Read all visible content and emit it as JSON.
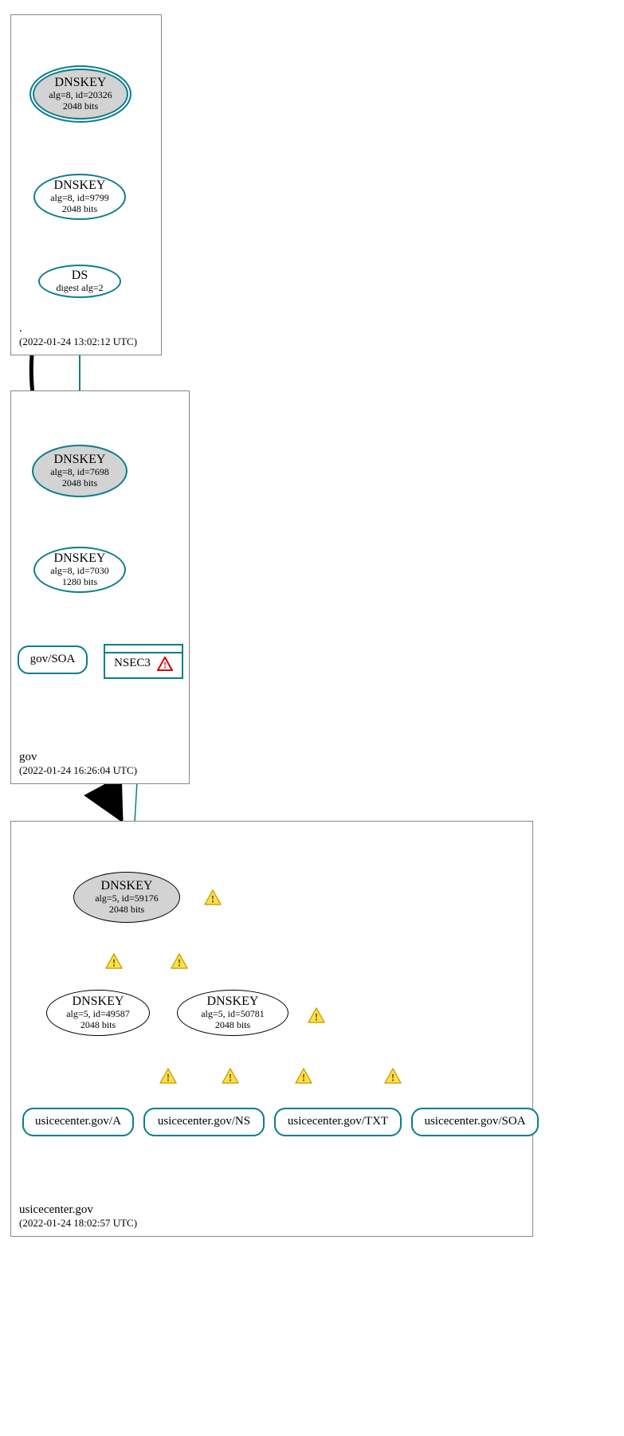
{
  "colors": {
    "teal": "#0a7e8c",
    "black": "#000000",
    "gray_fill": "#d3d3d3",
    "warn_fill": "#ffde4a",
    "warn_stroke": "#c9a200",
    "err_fill": "#ffffff",
    "err_stroke": "#d40000"
  },
  "zones": {
    "root": {
      "name": ".",
      "timestamp": "(2022-01-24 13:02:12 UTC)"
    },
    "gov": {
      "name": "gov",
      "timestamp": "(2022-01-24 16:26:04 UTC)"
    },
    "usicecenter": {
      "name": "usicecenter.gov",
      "timestamp": "(2022-01-24 18:02:57 UTC)"
    }
  },
  "nodes": {
    "root_ksk": {
      "title": "DNSKEY",
      "line2": "alg=8, id=20326",
      "line3": "2048 bits"
    },
    "root_zsk": {
      "title": "DNSKEY",
      "line2": "alg=8, id=9799",
      "line3": "2048 bits"
    },
    "root_ds": {
      "title": "DS",
      "line2": "digest alg=2"
    },
    "gov_ksk": {
      "title": "DNSKEY",
      "line2": "alg=8, id=7698",
      "line3": "2048 bits"
    },
    "gov_zsk": {
      "title": "DNSKEY",
      "line2": "alg=8, id=7030",
      "line3": "1280 bits"
    },
    "gov_soa": {
      "label": "gov/SOA"
    },
    "gov_nsec3": {
      "label": "NSEC3"
    },
    "uic_ksk": {
      "title": "DNSKEY",
      "line2": "alg=5, id=59176",
      "line3": "2048 bits"
    },
    "uic_zsk1": {
      "title": "DNSKEY",
      "line2": "alg=5, id=49587",
      "line3": "2048 bits"
    },
    "uic_zsk2": {
      "title": "DNSKEY",
      "line2": "alg=5, id=50781",
      "line3": "2048 bits"
    },
    "uic_a": {
      "label": "usicecenter.gov/A"
    },
    "uic_ns": {
      "label": "usicecenter.gov/NS"
    },
    "uic_txt": {
      "label": "usicecenter.gov/TXT"
    },
    "uic_soa": {
      "label": "usicecenter.gov/SOA"
    }
  },
  "icons": {
    "warning": "warning-triangle",
    "error": "error-triangle"
  },
  "chart_data": {
    "type": "graph",
    "description": "DNSSEC authentication chain / dnsviz-style delegation graph",
    "zones": [
      {
        "id": "root",
        "label": ".",
        "timestamp": "2022-01-24 13:02:12 UTC"
      },
      {
        "id": "gov",
        "label": "gov",
        "timestamp": "2022-01-24 16:26:04 UTC"
      },
      {
        "id": "usicecenter",
        "label": "usicecenter.gov",
        "timestamp": "2022-01-24 18:02:57 UTC"
      }
    ],
    "nodes": [
      {
        "id": "root_ksk",
        "zone": "root",
        "type": "DNSKEY",
        "role": "KSK",
        "alg": 8,
        "key_id": 20326,
        "bits": 2048,
        "trust_anchor": true
      },
      {
        "id": "root_zsk",
        "zone": "root",
        "type": "DNSKEY",
        "role": "ZSK",
        "alg": 8,
        "key_id": 9799,
        "bits": 2048
      },
      {
        "id": "root_ds",
        "zone": "root",
        "type": "DS",
        "digest_alg": 2
      },
      {
        "id": "gov_ksk",
        "zone": "gov",
        "type": "DNSKEY",
        "role": "KSK",
        "alg": 8,
        "key_id": 7698,
        "bits": 2048
      },
      {
        "id": "gov_zsk",
        "zone": "gov",
        "type": "DNSKEY",
        "role": "ZSK",
        "alg": 8,
        "key_id": 7030,
        "bits": 1280
      },
      {
        "id": "gov_soa",
        "zone": "gov",
        "type": "RRset",
        "name": "gov/SOA"
      },
      {
        "id": "gov_nsec3",
        "zone": "gov",
        "type": "NSEC3",
        "status": "error"
      },
      {
        "id": "uic_ksk",
        "zone": "usicecenter",
        "type": "DNSKEY",
        "role": "KSK",
        "alg": 5,
        "key_id": 59176,
        "bits": 2048,
        "status": "warning"
      },
      {
        "id": "uic_zsk1",
        "zone": "usicecenter",
        "type": "DNSKEY",
        "role": "ZSK",
        "alg": 5,
        "key_id": 49587,
        "bits": 2048
      },
      {
        "id": "uic_zsk2",
        "zone": "usicecenter",
        "type": "DNSKEY",
        "role": "ZSK",
        "alg": 5,
        "key_id": 50781,
        "bits": 2048,
        "status": "warning"
      },
      {
        "id": "uic_a",
        "zone": "usicecenter",
        "type": "RRset",
        "name": "usicecenter.gov/A"
      },
      {
        "id": "uic_ns",
        "zone": "usicecenter",
        "type": "RRset",
        "name": "usicecenter.gov/NS"
      },
      {
        "id": "uic_txt",
        "zone": "usicecenter",
        "type": "RRset",
        "name": "usicecenter.gov/TXT"
      },
      {
        "id": "uic_soa",
        "zone": "usicecenter",
        "type": "RRset",
        "name": "usicecenter.gov/SOA"
      }
    ],
    "edges": [
      {
        "from": "root_ksk",
        "to": "root_ksk",
        "kind": "self-sig",
        "color": "teal"
      },
      {
        "from": "root_ksk",
        "to": "root_zsk",
        "kind": "signs",
        "color": "teal"
      },
      {
        "from": "root_zsk",
        "to": "root_ds",
        "kind": "signs",
        "color": "teal"
      },
      {
        "from": "root_ds",
        "to": "gov_ksk",
        "kind": "ds-match",
        "color": "teal"
      },
      {
        "from": "root",
        "to": "gov",
        "kind": "delegation",
        "color": "black"
      },
      {
        "from": "gov_ksk",
        "to": "gov_ksk",
        "kind": "self-sig",
        "color": "teal"
      },
      {
        "from": "gov_ksk",
        "to": "gov_zsk",
        "kind": "signs",
        "color": "teal"
      },
      {
        "from": "gov_zsk",
        "to": "gov_soa",
        "kind": "signs",
        "color": "teal"
      },
      {
        "from": "gov_zsk",
        "to": "gov_nsec3",
        "kind": "signs",
        "color": "teal"
      },
      {
        "from": "gov_nsec3",
        "to": "uic_ksk",
        "kind": "insecure-deleg",
        "color": "teal"
      },
      {
        "from": "gov",
        "to": "usicecenter",
        "kind": "delegation",
        "color": "black"
      },
      {
        "from": "uic_ksk",
        "to": "uic_ksk",
        "kind": "self-sig",
        "color": "teal",
        "status": "warning"
      },
      {
        "from": "uic_ksk",
        "to": "uic_zsk1",
        "kind": "signs",
        "color": "teal",
        "status": "warning"
      },
      {
        "from": "uic_ksk",
        "to": "uic_zsk2",
        "kind": "signs",
        "color": "teal",
        "status": "warning"
      },
      {
        "from": "uic_zsk2",
        "to": "uic_zsk2",
        "kind": "self-sig",
        "color": "teal",
        "status": "warning"
      },
      {
        "from": "uic_zsk2",
        "to": "uic_a",
        "kind": "signs",
        "color": "teal",
        "status": "warning"
      },
      {
        "from": "uic_zsk2",
        "to": "uic_ns",
        "kind": "signs",
        "color": "teal",
        "status": "warning"
      },
      {
        "from": "uic_zsk2",
        "to": "uic_txt",
        "kind": "signs",
        "color": "teal",
        "status": "warning"
      },
      {
        "from": "uic_zsk2",
        "to": "uic_soa",
        "kind": "signs",
        "color": "teal",
        "status": "warning"
      }
    ]
  }
}
